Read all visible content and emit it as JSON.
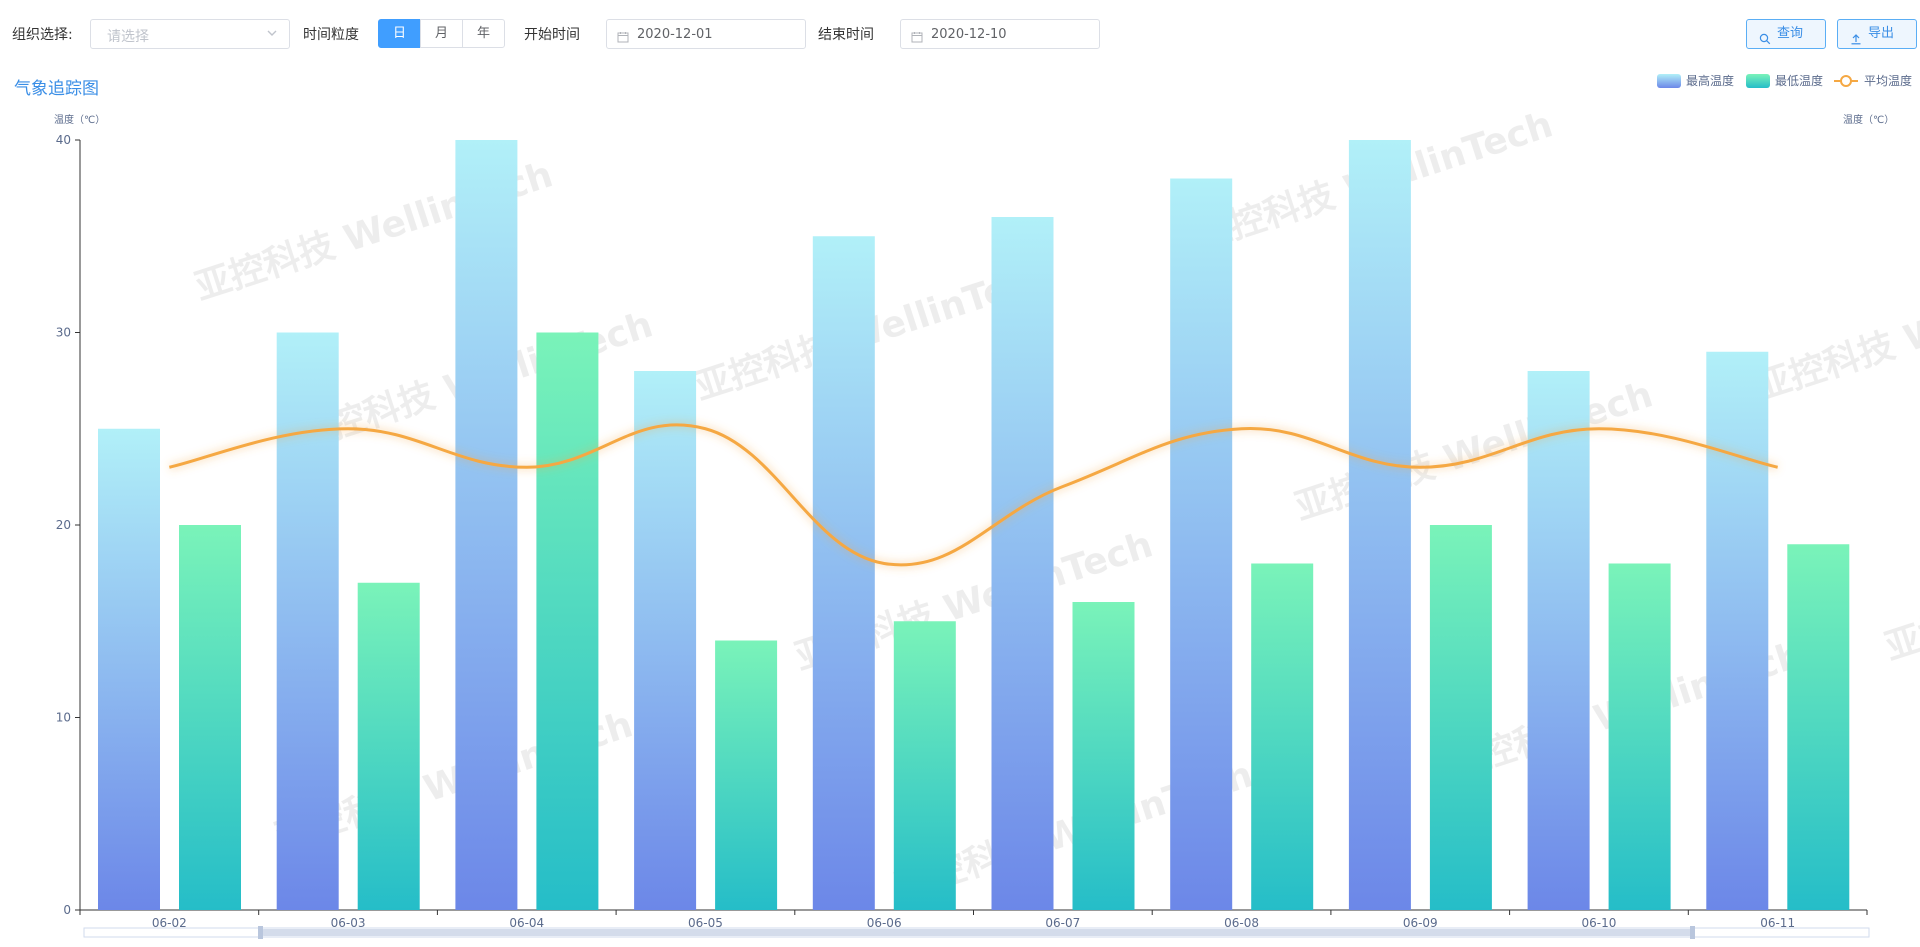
{
  "toolbar": {
    "org_label": "组织选择:",
    "org_placeholder": "请选择",
    "granularity_label": "时间粒度",
    "granularity_options": [
      "日",
      "月",
      "年"
    ],
    "granularity_selected": "日",
    "start_label": "开始时间",
    "start_value": "2020-12-01",
    "end_label": "结束时间",
    "end_value": "2020-12-10",
    "query_label": "查询",
    "export_label": "导出"
  },
  "panel": {
    "title": "气象追踪图"
  },
  "watermark": "亚控科技 WellinTech",
  "colors": {
    "accent": "#409eff",
    "max_top": "#b1f0f8",
    "max_bottom": "#6c87e8",
    "min_top": "#7af3b9",
    "min_bottom": "#25bdc8",
    "avg_line": "#f5a843"
  },
  "chart_data": {
    "type": "bar",
    "categories": [
      "06-02",
      "06-03",
      "06-04",
      "06-05",
      "06-06",
      "06-07",
      "06-08",
      "06-09",
      "06-10",
      "06-11"
    ],
    "series": [
      {
        "name": "最高温度",
        "type": "bar",
        "values": [
          25,
          30,
          40,
          28,
          35,
          36,
          38,
          40,
          28,
          29
        ]
      },
      {
        "name": "最低温度",
        "type": "bar",
        "values": [
          20,
          17,
          30,
          14,
          15,
          16,
          18,
          20,
          18,
          19
        ]
      },
      {
        "name": "平均温度",
        "type": "line",
        "values": [
          23,
          25,
          23,
          25,
          18,
          22,
          25,
          23,
          25,
          23
        ]
      }
    ],
    "ylabel_left": "温度（℃）",
    "ylabel_right": "温度（℃）",
    "ylim": [
      0,
      40
    ],
    "yticks": [
      0,
      10,
      20,
      30,
      40
    ],
    "grid": false,
    "legend_position": "top-right"
  }
}
